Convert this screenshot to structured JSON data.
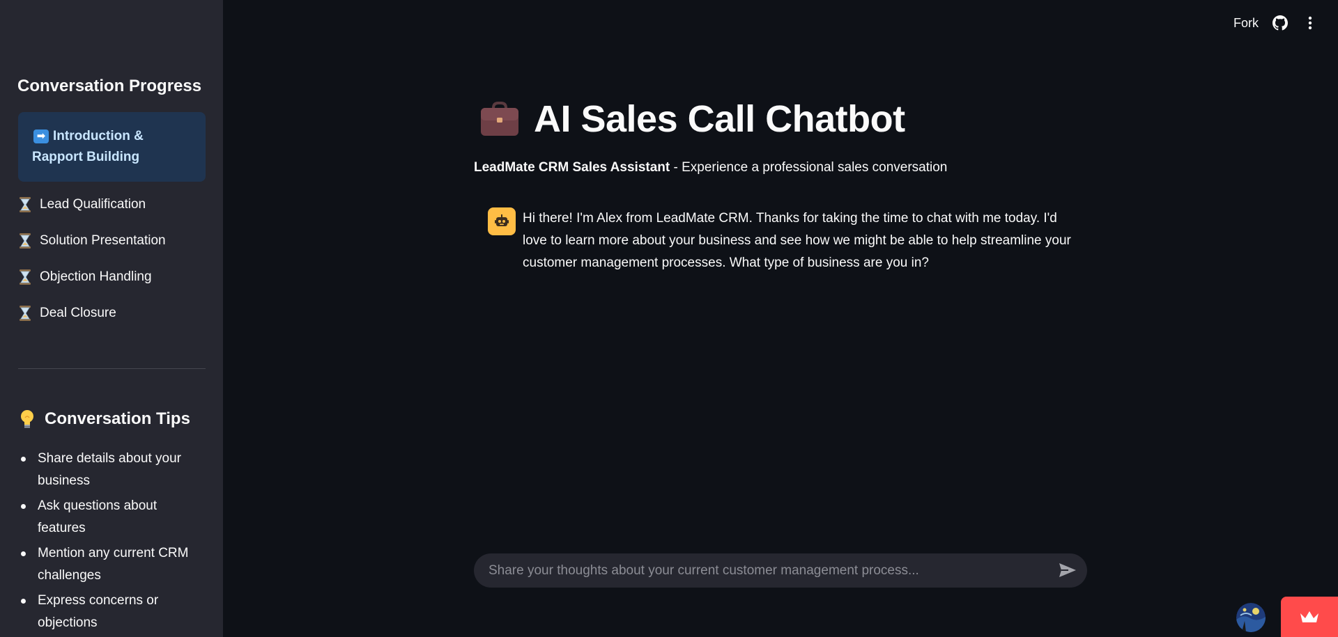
{
  "sidebar": {
    "title": "Conversation Progress",
    "active_stage": "Introduction & Rapport Building",
    "active_stage_line1": "Introduction &",
    "active_stage_line2": "Rapport Building",
    "stages": [
      {
        "label": "Lead Qualification"
      },
      {
        "label": "Solution Presentation"
      },
      {
        "label": "Objection Handling"
      },
      {
        "label": "Deal Closure"
      }
    ],
    "tips_title": "Conversation Tips",
    "tips": [
      "Share details about your business",
      "Ask questions about features",
      "Mention any current CRM challenges",
      "Express concerns or objections"
    ]
  },
  "header": {
    "fork_label": "Fork"
  },
  "main": {
    "title": "AI Sales Call Chatbot",
    "subtitle_bold": "LeadMate CRM Sales Assistant",
    "subtitle_rest": " - Experience a professional sales conversation",
    "messages": [
      {
        "role": "assistant",
        "text": "Hi there! I'm Alex from LeadMate CRM. Thanks for taking the time to chat with me today. I'd love to learn more about your business and see how we might be able to help streamline your customer management processes. What type of business are you in?"
      }
    ]
  },
  "chat_input": {
    "placeholder": "Share your thoughts about your current customer management process...",
    "value": ""
  },
  "icons": {
    "arrow": "right-arrow-emoji",
    "pending": "hourglass-icon",
    "tips": "lightbulb-icon",
    "title": "briefcase-icon",
    "bot": "robot-icon",
    "send": "send-icon",
    "github": "github-icon",
    "menu": "kebab-menu-icon",
    "streamlit": "crown-icon"
  },
  "colors": {
    "background": "#0e1117",
    "sidebar": "#262730",
    "active_stage_bg": "#1f3450",
    "active_stage_text": "#c9e6ff",
    "bot_avatar": "#ffbd45",
    "accent": "#ff4b4b"
  }
}
